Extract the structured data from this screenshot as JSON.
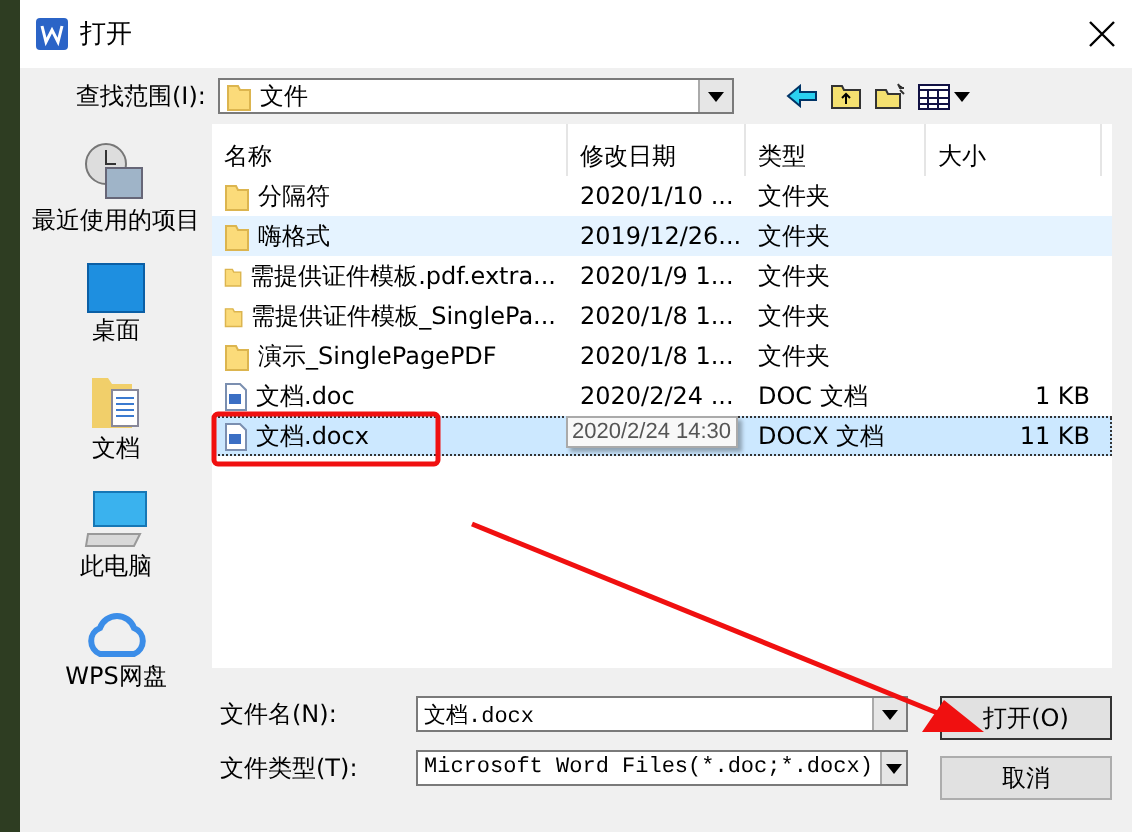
{
  "window": {
    "title": "打开"
  },
  "lookin": {
    "label": "查找范围(I):",
    "value": "文件"
  },
  "places": [
    {
      "label": "最近使用的项目",
      "kind": "recent"
    },
    {
      "label": "桌面",
      "kind": "desktop"
    },
    {
      "label": "文档",
      "kind": "documents"
    },
    {
      "label": "此电脑",
      "kind": "computer"
    },
    {
      "label": "WPS网盘",
      "kind": "cloud"
    }
  ],
  "table": {
    "columns": [
      "名称",
      "修改日期",
      "类型",
      "大小"
    ],
    "rows": [
      {
        "kind": "folder",
        "name": "分隔符",
        "date": "2020/1/10 ...",
        "type": "文件夹",
        "size": "",
        "selected": false,
        "hovered": false
      },
      {
        "kind": "folder",
        "name": "嗨格式",
        "date": "2019/12/26...",
        "type": "文件夹",
        "size": "",
        "selected": false,
        "hovered": true
      },
      {
        "kind": "folder",
        "name": "需提供证件模板.pdf.extra...",
        "date": "2020/1/9 1...",
        "type": "文件夹",
        "size": "",
        "selected": false,
        "hovered": false
      },
      {
        "kind": "folder",
        "name": "需提供证件模板_SinglePa...",
        "date": "2020/1/8 1...",
        "type": "文件夹",
        "size": "",
        "selected": false,
        "hovered": false
      },
      {
        "kind": "folder",
        "name": "演示_SinglePagePDF",
        "date": "2020/1/8 1...",
        "type": "文件夹",
        "size": "",
        "selected": false,
        "hovered": false
      },
      {
        "kind": "doc",
        "name": "文档.doc",
        "date": "2020/2/24 ...",
        "type": "DOC 文档",
        "size": "1 KB",
        "selected": false,
        "hovered": false
      },
      {
        "kind": "doc",
        "name": "文档.docx",
        "date": "",
        "tooltip": "2020/2/24 14:30",
        "type": "DOCX 文档",
        "size": "11 KB",
        "selected": true,
        "hovered": false
      }
    ]
  },
  "filename": {
    "label": "文件名(N):",
    "value": "文档.docx"
  },
  "filetype": {
    "label": "文件类型(T):",
    "value": "Microsoft Word Files(*.doc;*.docx)"
  },
  "buttons": [
    "打开(O)",
    "取消"
  ]
}
